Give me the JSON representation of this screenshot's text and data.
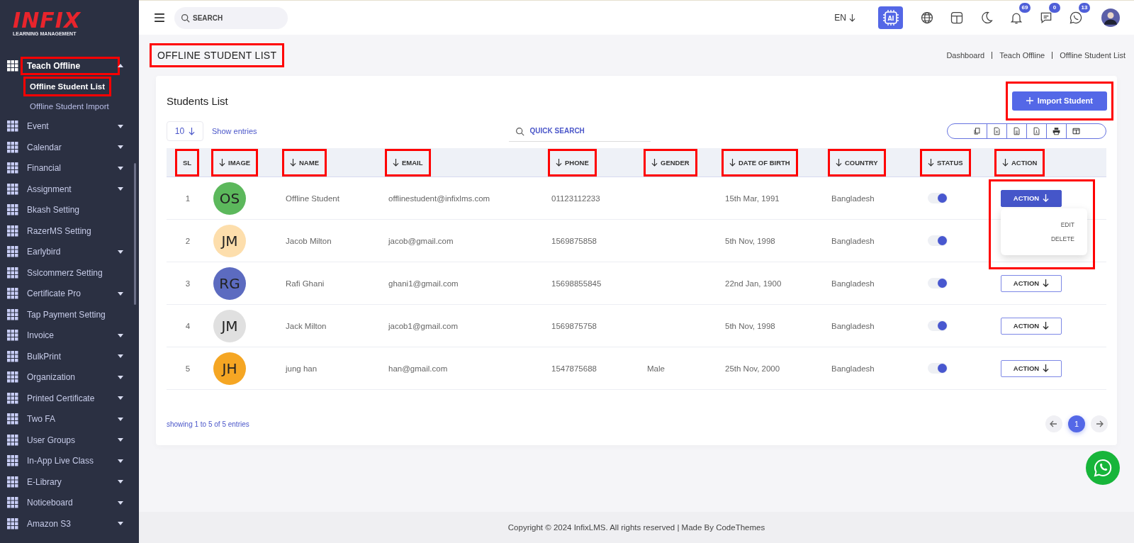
{
  "logo": {
    "name": "INFIX",
    "tagline": "LEARNING MANAGEMENT"
  },
  "sidebar": {
    "items": [
      {
        "label": "Teach Offline",
        "expandable": true,
        "expanded": true,
        "highlighted": true,
        "children": [
          {
            "label": "Offline Student List",
            "selected": true,
            "highlighted": true
          },
          {
            "label": "Offline Student Import",
            "selected": false,
            "highlighted": false
          }
        ]
      },
      {
        "label": "Event",
        "expandable": true,
        "expanded": false,
        "highlighted": false
      },
      {
        "label": "Calendar",
        "expandable": true,
        "expanded": false,
        "highlighted": false
      },
      {
        "label": "Financial",
        "expandable": true,
        "expanded": false,
        "highlighted": false
      },
      {
        "label": "Assignment",
        "expandable": true,
        "expanded": false,
        "highlighted": false
      },
      {
        "label": "Bkash Setting",
        "expandable": false,
        "expanded": false,
        "highlighted": false
      },
      {
        "label": "RazerMS Setting",
        "expandable": false,
        "expanded": false,
        "highlighted": false
      },
      {
        "label": "Earlybird",
        "expandable": true,
        "expanded": false,
        "highlighted": false
      },
      {
        "label": "Sslcommerz Setting",
        "expandable": false,
        "expanded": false,
        "highlighted": false
      },
      {
        "label": "Certificate Pro",
        "expandable": true,
        "expanded": false,
        "highlighted": false
      },
      {
        "label": "Tap Payment Setting",
        "expandable": false,
        "expanded": false,
        "highlighted": false
      },
      {
        "label": "Invoice",
        "expandable": true,
        "expanded": false,
        "highlighted": false
      },
      {
        "label": "BulkPrint",
        "expandable": true,
        "expanded": false,
        "highlighted": false
      },
      {
        "label": "Organization",
        "expandable": true,
        "expanded": false,
        "highlighted": false
      },
      {
        "label": "Printed Certificate",
        "expandable": true,
        "expanded": false,
        "highlighted": false
      },
      {
        "label": "Two FA",
        "expandable": true,
        "expanded": false,
        "highlighted": false
      },
      {
        "label": "User Groups",
        "expandable": true,
        "expanded": false,
        "highlighted": false
      },
      {
        "label": "In-App Live Class",
        "expandable": true,
        "expanded": false,
        "highlighted": false
      },
      {
        "label": "E-Library",
        "expandable": true,
        "expanded": false,
        "highlighted": false
      },
      {
        "label": "Noticeboard",
        "expandable": true,
        "expanded": false,
        "highlighted": false
      },
      {
        "label": "Amazon S3",
        "expandable": true,
        "expanded": false,
        "highlighted": false
      }
    ]
  },
  "topbar": {
    "search": {
      "placeholder": "SEARCH"
    },
    "language": "EN",
    "ai_label": "AI",
    "notifications": "69",
    "messages": "0",
    "chats": "13"
  },
  "page": {
    "title": "OFFLINE STUDENT LIST",
    "title_highlighted": true,
    "breadcrumb": [
      "Dashboard",
      "Teach Offline",
      "Offline Student List"
    ]
  },
  "card": {
    "title": "Students List",
    "import_button": {
      "label": "Import Student",
      "highlighted": true
    },
    "page_size": "10",
    "show_entries": "Show entries",
    "quick_search": {
      "placeholder": "QUICK SEARCH"
    }
  },
  "table": {
    "columns": [
      {
        "label": "SL",
        "sortable": false,
        "highlighted": true
      },
      {
        "label": "IMAGE",
        "sortable": true,
        "highlighted": true
      },
      {
        "label": "NAME",
        "sortable": true,
        "highlighted": true
      },
      {
        "label": "EMAIL",
        "sortable": true,
        "highlighted": true
      },
      {
        "label": "PHONE",
        "sortable": true,
        "highlighted": true
      },
      {
        "label": "GENDER",
        "sortable": true,
        "highlighted": true
      },
      {
        "label": "DATE OF BIRTH",
        "sortable": true,
        "highlighted": true
      },
      {
        "label": "COUNTRY",
        "sortable": true,
        "highlighted": true
      },
      {
        "label": "STATUS",
        "sortable": true,
        "highlighted": true
      },
      {
        "label": "ACTION",
        "sortable": true,
        "highlighted": true
      }
    ],
    "rows": [
      {
        "sl": "1",
        "initials": "OS",
        "color": "#5cb85c",
        "name": "Offline Student",
        "email": "offlinestudent@infixlms.com",
        "phone": "01123112233",
        "gender": "",
        "dob": "15th Mar, 1991",
        "country": "Bangladesh",
        "on": true,
        "action": {
          "label": "ACTION",
          "open": true
        }
      },
      {
        "sl": "2",
        "initials": "JM",
        "color": "#fddeac",
        "name": "Jacob Milton",
        "email": "jacob@gmail.com",
        "phone": "1569875858",
        "gender": "",
        "dob": "5th Nov, 1998",
        "country": "Bangladesh",
        "on": true
      },
      {
        "sl": "3",
        "initials": "RG",
        "color": "#5c6bc0",
        "name": "Rafi Ghani",
        "email": "ghani1@gmail.com",
        "phone": "15698855845",
        "gender": "",
        "dob": "22nd Jan, 1900",
        "country": "Bangladesh",
        "on": true,
        "action": {
          "label": "ACTION",
          "open": false
        }
      },
      {
        "sl": "4",
        "initials": "JM",
        "color": "#e0e0e0",
        "name": "Jack Milton",
        "email": "jacob1@gmail.com",
        "phone": "1569875758",
        "gender": "",
        "dob": "5th Nov, 1998",
        "country": "Bangladesh",
        "on": true,
        "action": {
          "label": "ACTION",
          "open": false
        }
      },
      {
        "sl": "5",
        "initials": "JH",
        "color": "#f5a623",
        "name": "jung han",
        "email": "han@gmail.com",
        "phone": "1547875688",
        "gender": "Male",
        "dob": "25th Nov, 2000",
        "country": "Bangladesh",
        "on": true,
        "action": {
          "label": "ACTION",
          "open": false
        }
      }
    ],
    "action_menu": {
      "items": [
        "EDIT",
        "DELETE"
      ],
      "highlighted": true
    }
  },
  "summary": "showing 1 to 5 of 5 entries",
  "pagination": {
    "pages": [
      {
        "label": "1",
        "selected": true
      }
    ]
  },
  "footer": "Copyright © 2024 InfixLMS. All rights reserved | Made By CodeThemes"
}
